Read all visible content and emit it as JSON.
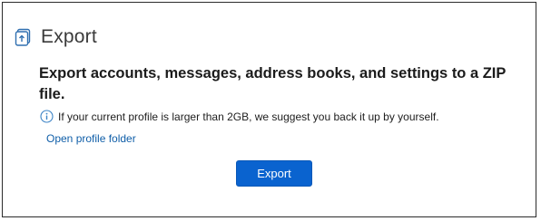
{
  "header": {
    "icon": "export-icon",
    "title": "Export"
  },
  "main": {
    "headline": "Export accounts, messages, address books, and settings to a ZIP file.",
    "info": {
      "icon": "info-icon",
      "text": "If your current profile is larger than 2GB, we suggest you back it up by yourself."
    },
    "link_label": "Open profile folder",
    "export_button_label": "Export"
  },
  "colors": {
    "accent": "#0a63cf",
    "link": "#0f5ea8",
    "info_icon": "#3d84c6"
  }
}
